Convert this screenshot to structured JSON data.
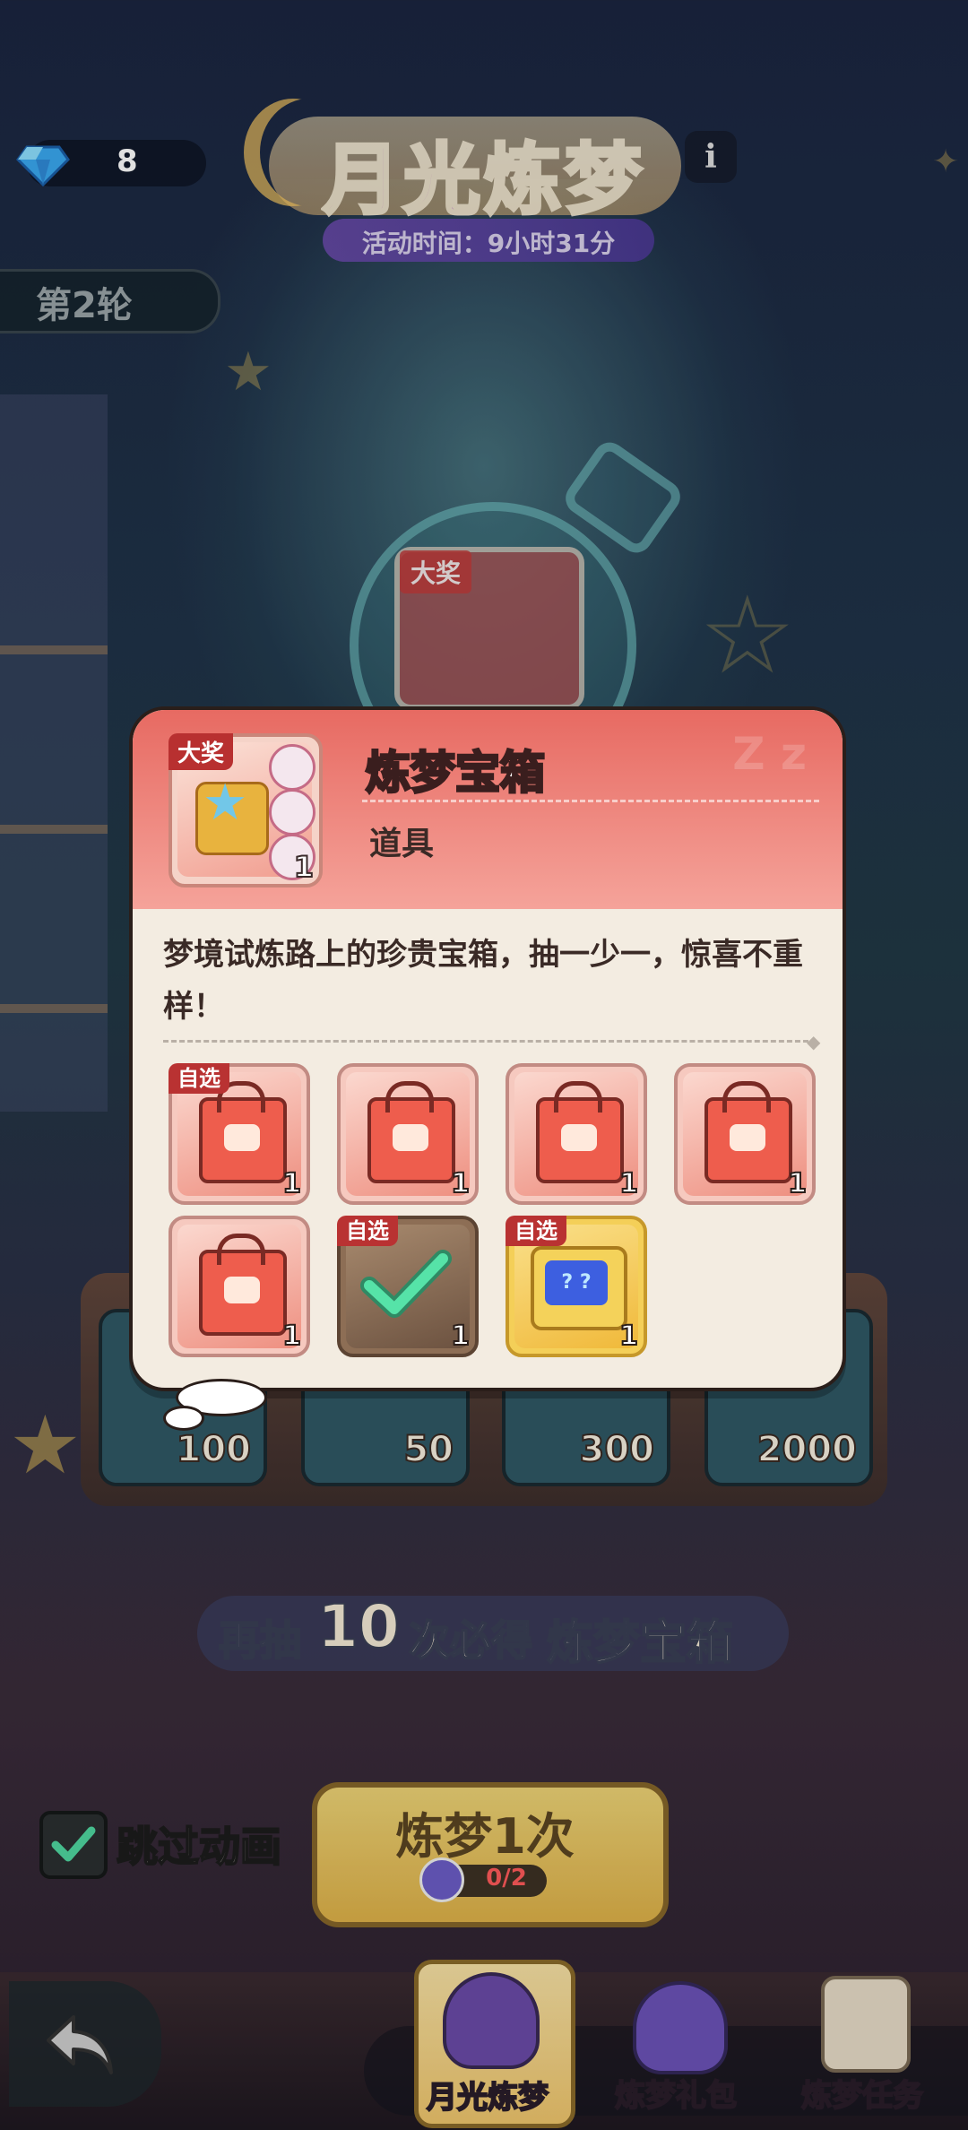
{
  "header": {
    "gem_count": "8",
    "title": "月光炼梦",
    "event_time": "活动时间：9小时31分",
    "info_label": "i",
    "round": "第2轮"
  },
  "background": {
    "grand_prize_tag": "大奖",
    "reward_values": [
      "100",
      "50",
      "300",
      "2000"
    ],
    "guarantee": {
      "prefix": "再抽",
      "count": "10",
      "middle": "次必得",
      "item": "炼梦宝箱"
    }
  },
  "controls": {
    "skip_animation_label": "跳过动画",
    "skip_animation_checked": true,
    "draw_button_label": "炼梦1次",
    "draw_cost": "0/2"
  },
  "tabs": [
    {
      "label": "月光炼梦",
      "icon": "moon-machine-icon",
      "active": true
    },
    {
      "label": "炼梦礼包",
      "icon": "gift-bag-icon",
      "active": false
    },
    {
      "label": "炼梦任务",
      "icon": "task-scroll-icon",
      "active": false
    }
  ],
  "modal": {
    "item_tag": "大奖",
    "item_count": "1",
    "title": "炼梦宝箱",
    "subtitle": "道具",
    "description": "梦境试炼路上的珍贵宝箱，抽一少一，惊喜不重样！",
    "rewards": [
      {
        "tag": "自选",
        "icon": "gift-bag-icon",
        "count": "1",
        "style": "red"
      },
      {
        "tag": "",
        "icon": "gift-bag-icon",
        "count": "1",
        "style": "red"
      },
      {
        "tag": "",
        "icon": "gift-bag-icon",
        "count": "1",
        "style": "red"
      },
      {
        "tag": "",
        "icon": "gift-bag-icon",
        "count": "1",
        "style": "red"
      },
      {
        "tag": "",
        "icon": "gift-bag-icon",
        "count": "1",
        "style": "red"
      },
      {
        "tag": "自选",
        "icon": "checked-chest-icon",
        "count": "1",
        "style": "brown"
      },
      {
        "tag": "自选",
        "icon": "robot-tv-icon",
        "count": "1",
        "style": "yellow"
      }
    ]
  },
  "colors": {
    "modal_header": "#e76a62",
    "modal_body": "#f3ece1",
    "tag_red": "#b93232",
    "check_green": "#4fd6a0",
    "draw_button": "#f0c66c"
  }
}
